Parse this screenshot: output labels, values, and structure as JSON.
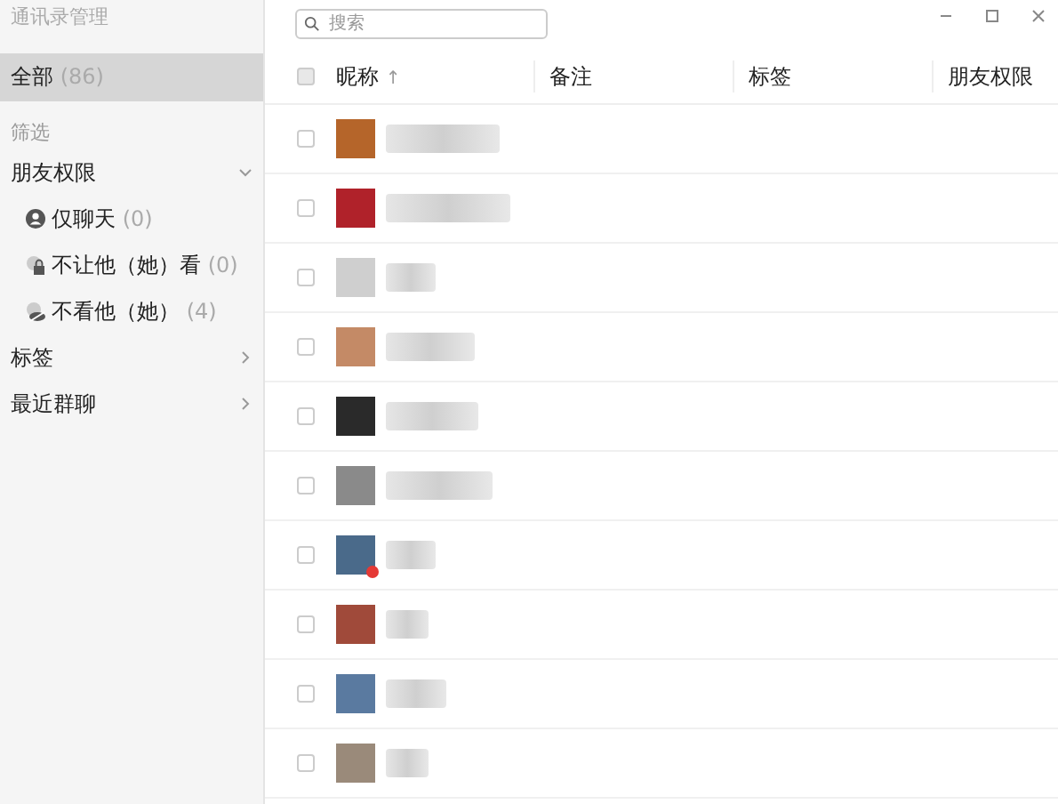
{
  "window": {
    "title": "通讯录管理"
  },
  "sidebar": {
    "items": [
      {
        "label": "全部",
        "count": "(86)",
        "selected": true
      }
    ],
    "filter_heading": "筛选",
    "groups": [
      {
        "label": "朋友权限",
        "expanded": true,
        "children": [
          {
            "kind": "chat-only",
            "label": "仅聊天",
            "count": "(0)"
          },
          {
            "kind": "hide-mine",
            "label": "不让他（她）看",
            "count": "(0)"
          },
          {
            "kind": "hide-theirs",
            "label": "不看他（她）",
            "count": "(4)"
          }
        ]
      },
      {
        "label": "标签",
        "expanded": false
      },
      {
        "label": "最近群聊",
        "expanded": false
      }
    ]
  },
  "search": {
    "placeholder": "搜索"
  },
  "table": {
    "all_checked": false,
    "columns": [
      {
        "label": "昵称",
        "sort_mark": "↑"
      },
      {
        "label": "备注"
      },
      {
        "label": "标签"
      },
      {
        "label": "朋友权限"
      }
    ],
    "rows": [
      {
        "checked": false,
        "badge": false
      },
      {
        "checked": false,
        "badge": false
      },
      {
        "checked": false,
        "badge": false
      },
      {
        "checked": false,
        "badge": false
      },
      {
        "checked": false,
        "badge": false
      },
      {
        "checked": false,
        "badge": false
      },
      {
        "checked": false,
        "badge": true
      },
      {
        "checked": false,
        "badge": false
      },
      {
        "checked": false,
        "badge": false
      },
      {
        "checked": false,
        "badge": false
      }
    ]
  }
}
